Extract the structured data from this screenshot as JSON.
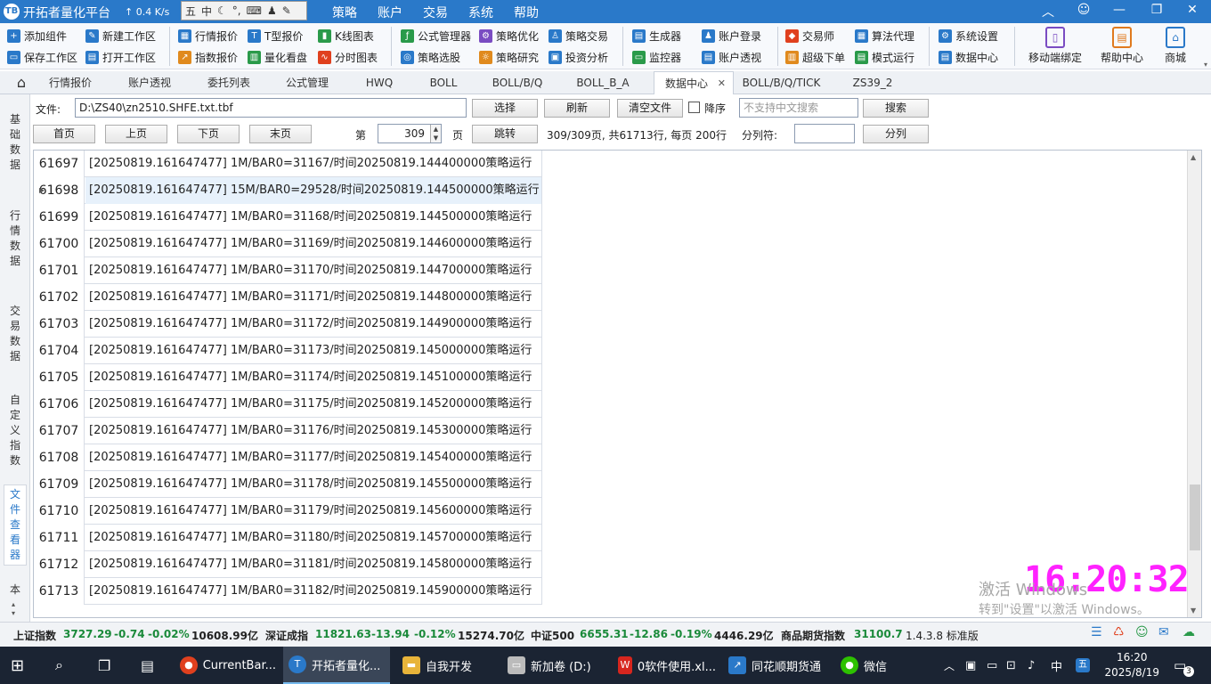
{
  "app": {
    "logo": "TB",
    "title": "开拓者量化平台",
    "net_speed": "↑ 0.4 K/s"
  },
  "ime": {
    "items": [
      "五",
      "中",
      "☾",
      "°,",
      "⌨",
      "♟",
      "✎"
    ]
  },
  "menu": [
    "策略",
    "账户",
    "交易",
    "系统",
    "帮助"
  ],
  "window_controls": [
    "︿",
    "☺",
    "—",
    "❐",
    "✕"
  ],
  "toolbar": {
    "buttons": [
      {
        "label": "添加组件",
        "icon": "add-component-icon",
        "color": "#2a79c9"
      },
      {
        "label": "保存工作区",
        "icon": "save-workspace-icon",
        "color": "#2a79c9"
      },
      {
        "label": "新建工作区",
        "icon": "new-workspace-icon",
        "color": "#2a79c9"
      },
      {
        "label": "打开工作区",
        "icon": "open-workspace-icon",
        "color": "#2a79c9"
      },
      {
        "label": "行情报价",
        "icon": "quote-icon",
        "color": "#2a79c9"
      },
      {
        "label": "指数报价",
        "icon": "index-quote-icon",
        "color": "#e08a1e"
      },
      {
        "label": "T型报价",
        "icon": "t-quote-icon",
        "color": "#2a79c9"
      },
      {
        "label": "量化看盘",
        "icon": "quant-board-icon",
        "color": "#2a9a4a"
      },
      {
        "label": "K线图表",
        "icon": "kline-chart-icon",
        "color": "#2a9a4a"
      },
      {
        "label": "分时图表",
        "icon": "timeshare-chart-icon",
        "color": "#e0401e"
      },
      {
        "label": "公式管理器",
        "icon": "formula-manager-icon",
        "color": "#2a9a4a"
      },
      {
        "label": "策略选股",
        "icon": "stock-pick-icon",
        "color": "#2a79c9"
      },
      {
        "label": "策略优化",
        "icon": "strategy-optimize-icon",
        "color": "#7a4cc2"
      },
      {
        "label": "策略研究",
        "icon": "strategy-research-icon",
        "color": "#e08a1e"
      },
      {
        "label": "策略交易",
        "icon": "strategy-trade-icon",
        "color": "#2a79c9"
      },
      {
        "label": "投资分析",
        "icon": "invest-analysis-icon",
        "color": "#2a79c9"
      },
      {
        "label": "生成器",
        "icon": "generator-icon",
        "color": "#2a79c9"
      },
      {
        "label": "监控器",
        "icon": "monitor-icon",
        "color": "#2a9a4a"
      },
      {
        "label": "账户登录",
        "icon": "account-login-icon",
        "color": "#2a79c9"
      },
      {
        "label": "账户透视",
        "icon": "account-view-icon",
        "color": "#2a79c9"
      },
      {
        "label": "交易师",
        "icon": "trader-icon",
        "color": "#e0401e"
      },
      {
        "label": "超级下单",
        "icon": "super-order-icon",
        "color": "#e08a1e"
      },
      {
        "label": "算法代理",
        "icon": "algo-proxy-icon",
        "color": "#2a79c9"
      },
      {
        "label": "模式运行",
        "icon": "mode-run-icon",
        "color": "#2a9a4a"
      },
      {
        "label": "系统设置",
        "icon": "settings-icon",
        "color": "#2a79c9"
      },
      {
        "label": "数据中心",
        "icon": "data-center-icon",
        "color": "#2a79c9"
      }
    ],
    "big": [
      {
        "label": "移动端绑定",
        "icon": "mobile-bind-icon"
      },
      {
        "label": "帮助中心",
        "icon": "help-center-icon"
      },
      {
        "label": "商城",
        "icon": "store-icon"
      }
    ]
  },
  "tabs": {
    "home_icon": "⌂",
    "items": [
      "行情报价",
      "账户透视",
      "委托列表",
      "公式管理",
      "HWQ",
      "BOLL",
      "BOLL/B/Q",
      "BOLL_B_A",
      "数据中心",
      "BOLL/B/Q/TICK",
      "ZS39_2"
    ],
    "active_index": 8,
    "close_glyph": "✕"
  },
  "leftnav": [
    "基础数据",
    "行情数据",
    "交易数据",
    "自定义指数",
    "文件查看器",
    "本"
  ],
  "file_panel": {
    "file_label": "文件:",
    "file_path": "D:\\ZS40\\zn2510.SHFE.txt.tbf",
    "select_btn": "选择",
    "refresh_btn": "刷新",
    "clear_btn": "清空文件",
    "desc_label": "降序",
    "search_placeholder": "不支持中文搜索",
    "search_btn": "搜索",
    "first_btn": "首页",
    "prev_btn": "上页",
    "next_btn": "下页",
    "last_btn": "末页",
    "page_prefix": "第",
    "page_value": "309",
    "page_suffix": "页",
    "jump_btn": "跳转",
    "page_info": "309/309页, 共61713行, 每页 200行",
    "sep_label": "分列符:",
    "split_btn": "分列"
  },
  "grid": {
    "selected_index": 1,
    "rows": [
      {
        "num": "61697",
        "text": "[20250819.161647477] 1M/BAR0=31167/时间20250819.144400000策略运行"
      },
      {
        "num": "61698",
        "text": "[20250819.161647477] 15M/BAR0=29528/时间20250819.144500000策略运行"
      },
      {
        "num": "61699",
        "text": "[20250819.161647477] 1M/BAR0=31168/时间20250819.144500000策略运行"
      },
      {
        "num": "61700",
        "text": "[20250819.161647477] 1M/BAR0=31169/时间20250819.144600000策略运行"
      },
      {
        "num": "61701",
        "text": "[20250819.161647477] 1M/BAR0=31170/时间20250819.144700000策略运行"
      },
      {
        "num": "61702",
        "text": "[20250819.161647477] 1M/BAR0=31171/时间20250819.144800000策略运行"
      },
      {
        "num": "61703",
        "text": "[20250819.161647477] 1M/BAR0=31172/时间20250819.144900000策略运行"
      },
      {
        "num": "61704",
        "text": "[20250819.161647477] 1M/BAR0=31173/时间20250819.145000000策略运行"
      },
      {
        "num": "61705",
        "text": "[20250819.161647477] 1M/BAR0=31174/时间20250819.145100000策略运行"
      },
      {
        "num": "61706",
        "text": "[20250819.161647477] 1M/BAR0=31175/时间20250819.145200000策略运行"
      },
      {
        "num": "61707",
        "text": "[20250819.161647477] 1M/BAR0=31176/时间20250819.145300000策略运行"
      },
      {
        "num": "61708",
        "text": "[20250819.161647477] 1M/BAR0=31177/时间20250819.145400000策略运行"
      },
      {
        "num": "61709",
        "text": "[20250819.161647477] 1M/BAR0=31178/时间20250819.145500000策略运行"
      },
      {
        "num": "61710",
        "text": "[20250819.161647477] 1M/BAR0=31179/时间20250819.145600000策略运行"
      },
      {
        "num": "61711",
        "text": "[20250819.161647477] 1M/BAR0=31180/时间20250819.145700000策略运行"
      },
      {
        "num": "61712",
        "text": "[20250819.161647477] 1M/BAR0=31181/时间20250819.145800000策略运行"
      },
      {
        "num": "61713",
        "text": "[20250819.161647477] 1M/BAR0=31182/时间20250819.145900000策略运行"
      }
    ],
    "scroll_position": 0.86
  },
  "overlay": {
    "clock": "16:20:32",
    "watermark_line1": "激活 Windows",
    "watermark_line2": "转到\"设置\"以激活 Windows。"
  },
  "status": {
    "sh_name": "上证指数",
    "sh_price": "3727.29",
    "sh_change": "-0.74",
    "sh_pct": "-0.02%",
    "sh_amount": "10608.99亿",
    "sz_name": "深证成指",
    "sz_price": "11821.63",
    "sz_change": "-13.94",
    "sz_pct": "-0.12%",
    "sz_amount": "15274.70亿",
    "zz_name": "中证500",
    "zz_price": "6655.31",
    "zz_change": "-12.86",
    "zz_pct": "-0.19%",
    "zz_amount": "4446.29亿",
    "cf_name": "商品期货指数",
    "cf_price": "31100.7",
    "version": "1.4.3.8 标准版",
    "colors": {
      "up_down": "#1a8a3a"
    }
  },
  "taskbar": {
    "items": [
      {
        "label": "CurrentBar...",
        "icon": "chrome-icon"
      },
      {
        "label": "开拓者量化...",
        "icon": "tb-app-icon"
      },
      {
        "label": "自我开发",
        "icon": "folder-icon"
      },
      {
        "label": "新加卷 (D:)",
        "icon": "drive-icon"
      },
      {
        "label": "0软件使用.xl...",
        "icon": "wps-icon"
      },
      {
        "label": "同花顺期货通",
        "icon": "ths-icon"
      },
      {
        "label": "微信",
        "icon": "wechat-icon"
      }
    ],
    "tray": {
      "ime": "中",
      "ime2": "五",
      "time": "16:20",
      "date": "2025/8/19",
      "notify_count": "3"
    }
  }
}
